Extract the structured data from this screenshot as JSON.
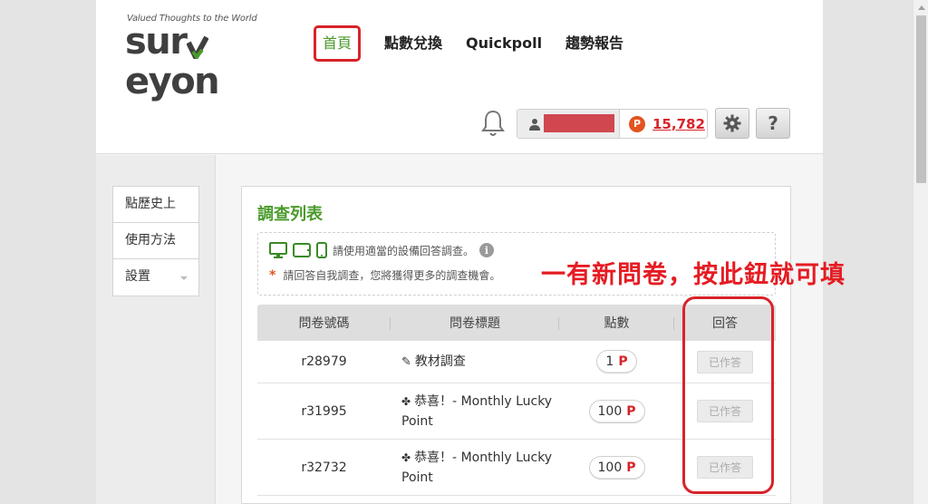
{
  "header": {
    "tagline": "Valued Thoughts to the World",
    "logo": {
      "part1": "sur",
      "part2": "eyon",
      "part3": "on"
    },
    "nav": [
      {
        "label": "首頁",
        "active": true
      },
      {
        "label": "點數兌換",
        "active": false
      },
      {
        "label": "Quickpoll",
        "active": false
      },
      {
        "label": "趨勢報告",
        "active": false
      }
    ],
    "user": {
      "points_icon": "P",
      "points": "15,782"
    },
    "help_label": "?"
  },
  "sidebar": {
    "items": [
      {
        "label": "點歷史上"
      },
      {
        "label": "使用方法"
      },
      {
        "label": "設置"
      }
    ]
  },
  "main": {
    "title": "調查列表",
    "notice": {
      "device_text": "請使用適當的設備回答調查。",
      "info_icon": "i",
      "star": "*",
      "self_survey_text": "請回答自我調查，您將獲得更多的調查機會。"
    },
    "table": {
      "headers": [
        "問卷號碼",
        "問卷標題",
        "點數",
        "回答"
      ],
      "rows": [
        {
          "id": "r28979",
          "icon": "✎",
          "title": "教材調查",
          "points": "1",
          "unit": "P",
          "status": "已作答"
        },
        {
          "id": "r31995",
          "icon": "✤",
          "title": "恭喜！- Monthly Lucky Point",
          "points": "100",
          "unit": "P",
          "status": "已作答"
        },
        {
          "id": "r32732",
          "icon": "✤",
          "title": "恭喜！- Monthly Lucky Point",
          "points": "100",
          "unit": "P",
          "status": "已作答"
        }
      ]
    }
  },
  "annotation": {
    "text": "一有新問卷，按此鈕就可填"
  },
  "colors": {
    "brand_green": "#4a9a2b",
    "accent_red": "#d8232a",
    "coin_orange": "#e2531f"
  },
  "icons": [
    "bell-icon",
    "user-icon",
    "gear-icon",
    "help-icon",
    "desktop-icon",
    "tablet-icon",
    "phone-icon",
    "info-icon",
    "pencil-icon",
    "clover-icon"
  ]
}
